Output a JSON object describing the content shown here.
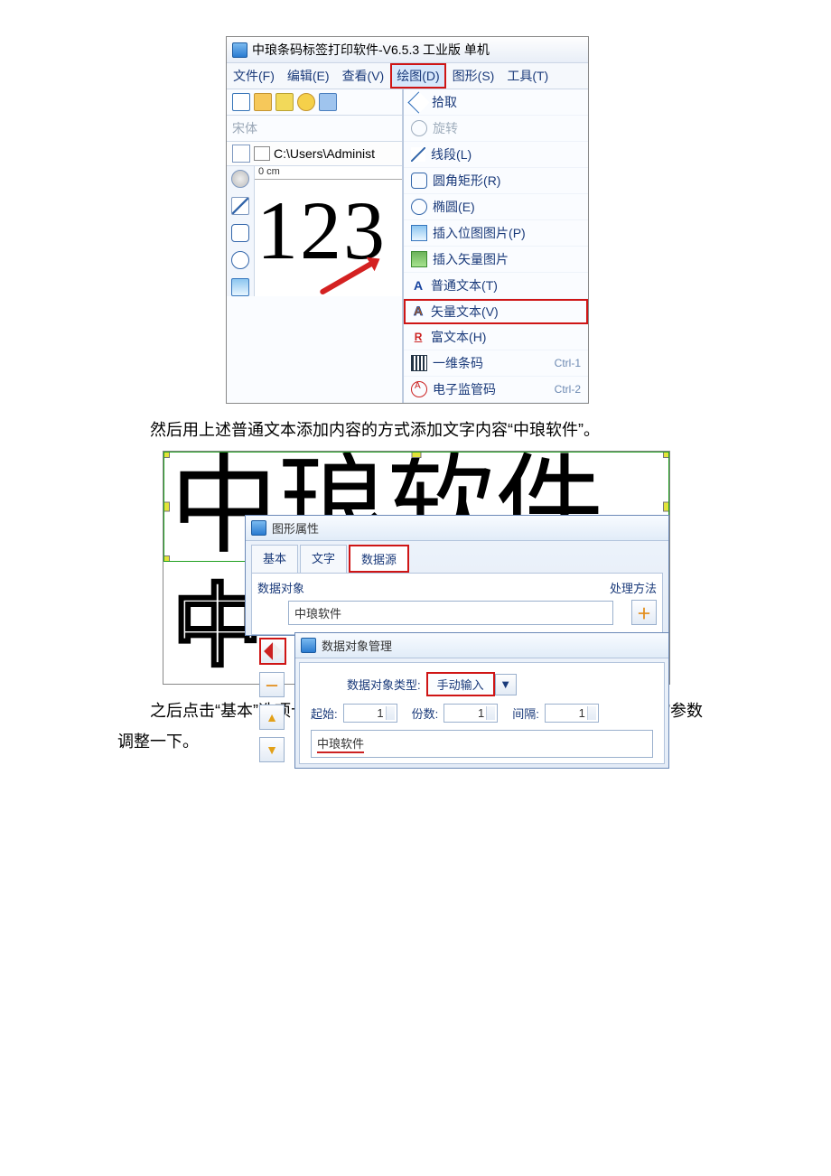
{
  "sc1": {
    "title": "中琅条码标签打印软件-V6.5.3 工业版 单机",
    "menu": {
      "file": "文件(F)",
      "edit": "编辑(E)",
      "view": "查看(V)",
      "draw": "绘图(D)",
      "shape": "图形(S)",
      "tool": "工具(T)"
    },
    "font_placeholder": "宋体",
    "path": "C:\\Users\\Administ",
    "ruler": "0 cm",
    "canvas_preview_text": "123",
    "dropdown": {
      "pick": "拾取",
      "rotate": "旋转",
      "line": "线段(L)",
      "roundrect": "圆角矩形(R)",
      "ellipse": "椭圆(E)",
      "bitmap": "插入位图图片(P)",
      "vectorimg": "插入矢量图片",
      "plaintext": "普通文本(T)",
      "vectortext": "矢量文本(V)",
      "richtext": "富文本(H)",
      "barcode": "一维条码",
      "ecode": "电子监管码",
      "sc1_shortcut_bar": "Ctrl-1",
      "sc1_shortcut_ecode": "Ctrl-2"
    }
  },
  "caption1": "然后用上述普通文本添加内容的方式添加文字内容“中琅软件”。",
  "sc2": {
    "big_text": "中琅软件",
    "outline_char": "中",
    "prop_title": "图形属性",
    "tabs": {
      "basic": "基本",
      "text": "文字",
      "datasrc": "数据源"
    },
    "label_data_object": "数据对象",
    "label_process": "处理方法",
    "list_value": "中琅软件",
    "sub_title": "数据对象管理",
    "label_type": "数据对象类型:",
    "type_value": "手动输入",
    "label_start": "起始:",
    "start_value": "1",
    "label_count": "份数:",
    "count_value": "1",
    "label_gap": "间隔:",
    "gap_value": "1",
    "textarea_value": "中琅软件"
  },
  "caption2": "之后点击“基本”选项卡，将“填充类型、背景色”和“线条线型、颜色、粗细”参数调整一下。"
}
